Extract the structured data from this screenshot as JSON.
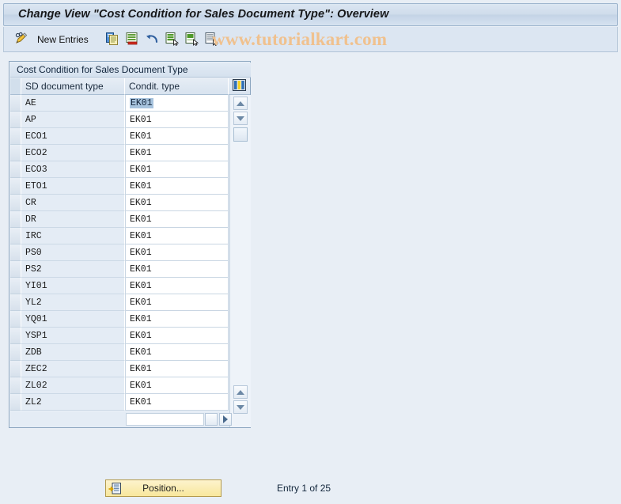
{
  "window": {
    "title": "Change View \"Cost Condition for Sales Document Type\": Overview"
  },
  "toolbar": {
    "edit_icon": "pencil-edit-icon",
    "new_entries_label": "New Entries",
    "icons": [
      {
        "name": "copy-icon",
        "title": "Copy As"
      },
      {
        "name": "delete-icon",
        "title": "Delete"
      },
      {
        "name": "undo-icon",
        "title": "Undo Change"
      },
      {
        "name": "select-all-icon",
        "title": "Select All"
      },
      {
        "name": "select-block-icon",
        "title": "Select Block"
      },
      {
        "name": "deselect-all-icon",
        "title": "Deselect All"
      }
    ],
    "watermark": "www.tutorialkart.com"
  },
  "panel": {
    "caption": "Cost Condition for Sales Document Type",
    "columns": [
      "SD document type",
      "Condit. type"
    ],
    "config_icon": "column-config-icon",
    "rows": [
      {
        "sd_document_type": "AE",
        "condition_type": "EK01",
        "selected": true
      },
      {
        "sd_document_type": "AP",
        "condition_type": "EK01",
        "selected": false
      },
      {
        "sd_document_type": "ECO1",
        "condition_type": "EK01",
        "selected": false
      },
      {
        "sd_document_type": "ECO2",
        "condition_type": "EK01",
        "selected": false
      },
      {
        "sd_document_type": "ECO3",
        "condition_type": "EK01",
        "selected": false
      },
      {
        "sd_document_type": "ETO1",
        "condition_type": "EK01",
        "selected": false
      },
      {
        "sd_document_type": "CR",
        "condition_type": "EK01",
        "selected": false
      },
      {
        "sd_document_type": "DR",
        "condition_type": "EK01",
        "selected": false
      },
      {
        "sd_document_type": "IRC",
        "condition_type": "EK01",
        "selected": false
      },
      {
        "sd_document_type": "PS0",
        "condition_type": "EK01",
        "selected": false
      },
      {
        "sd_document_type": "PS2",
        "condition_type": "EK01",
        "selected": false
      },
      {
        "sd_document_type": "YI01",
        "condition_type": "EK01",
        "selected": false
      },
      {
        "sd_document_type": "YL2",
        "condition_type": "EK01",
        "selected": false
      },
      {
        "sd_document_type": "YQ01",
        "condition_type": "EK01",
        "selected": false
      },
      {
        "sd_document_type": "YSP1",
        "condition_type": "EK01",
        "selected": false
      },
      {
        "sd_document_type": "ZDB",
        "condition_type": "EK01",
        "selected": false
      },
      {
        "sd_document_type": "ZEC2",
        "condition_type": "EK01",
        "selected": false
      },
      {
        "sd_document_type": "ZL02",
        "condition_type": "EK01",
        "selected": false
      },
      {
        "sd_document_type": "ZL2",
        "condition_type": "EK01",
        "selected": false
      }
    ]
  },
  "footer": {
    "position_button": "Position...",
    "position_icon": "position-icon",
    "entry_status": "Entry 1 of 25"
  },
  "colors": {
    "app_background": "#e8eef5",
    "title_bar": "#cfdceb",
    "toolbar": "#dce6f2",
    "panel_border": "#8ca6c0",
    "row_alt": "#e4ecf5",
    "selection": "#a8c4de",
    "watermark": "#f0c18e",
    "button_yellow": "#f8e79c"
  }
}
